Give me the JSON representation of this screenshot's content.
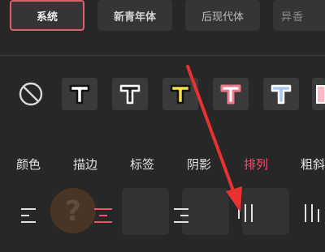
{
  "font_row": {
    "items": [
      {
        "label": "系统",
        "selected": true
      },
      {
        "label": "新青年体"
      },
      {
        "label": "后现代体"
      },
      {
        "label": "异香"
      }
    ]
  },
  "text_styles": [
    {
      "name": "none",
      "icon": "prohibited-icon"
    },
    {
      "name": "white-outline-black",
      "glyph": "T",
      "fill": "#ffffff",
      "stroke": "#111111"
    },
    {
      "name": "black-outline-white",
      "glyph": "T",
      "fill": "#222222",
      "stroke": "#ffffff"
    },
    {
      "name": "yellow-outline-black",
      "glyph": "T",
      "fill": "#f4e04d",
      "stroke": "#111111"
    },
    {
      "name": "white-outline-pink",
      "glyph": "T",
      "fill": "#ffffff",
      "stroke": "#f07a8a"
    },
    {
      "name": "blue-outline-white",
      "glyph": "T",
      "fill": "#a9c8f2",
      "stroke": "#ffffff"
    },
    {
      "name": "pink-partial",
      "glyph": "T",
      "fill": "#ffb6c6",
      "stroke": "#ffffff"
    }
  ],
  "tabs": [
    {
      "label": "颜色"
    },
    {
      "label": "描边"
    },
    {
      "label": "标签"
    },
    {
      "label": "阴影"
    },
    {
      "label": "排列",
      "active": true
    },
    {
      "label": "粗斜"
    }
  ],
  "align_options": [
    {
      "name": "align-left-icon"
    },
    {
      "name": "align-center-icon"
    },
    {
      "name": "align-right-icon"
    },
    {
      "name": "vertical-text-icon"
    },
    {
      "name": "vertical-right-icon"
    }
  ],
  "colors": {
    "accent": "#ff4a6b",
    "arrow": "#e8322f",
    "background": "#272727"
  }
}
